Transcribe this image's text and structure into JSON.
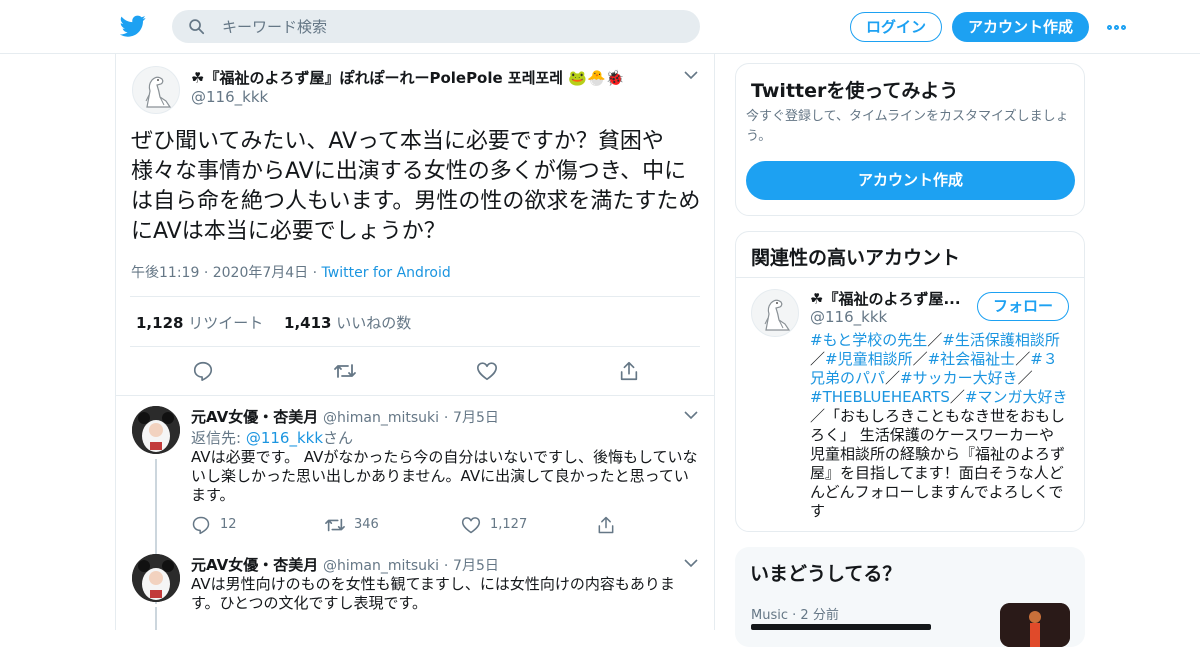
{
  "header": {
    "search_placeholder": "キーワード検索",
    "login_label": "ログイン",
    "signup_label": "アカウント作成"
  },
  "tweet": {
    "author_name": "☘『福祉のよろず屋』ぽれぽーれーPolePole 포레포레",
    "author_emojis": "🐸🐣🐞",
    "author_handle": "@116_kkk",
    "text": "ぜひ聞いてみたい、AVって本当に必要ですか？貧困や様々な事情からAVに出演する女性の多くが傷つき、中には自ら命を絶つ人もいます。男性の性の欲求を満たすためにAVは本当に必要でしょうか？",
    "time": "午後11:19",
    "date": "2020年7月4日",
    "sep": "·",
    "source": "Twitter for Android",
    "retweets_count": "1,128",
    "retweets_label": "リツイート",
    "likes_count": "1,413",
    "likes_label": "いいねの数"
  },
  "replies": [
    {
      "name": "元AV女優・杏美月",
      "handle": "@himan_mitsuki",
      "date": "7月5日",
      "reply_to_prefix": "返信先: ",
      "reply_to_handle": "@116_kkk",
      "reply_to_suffix": "さん",
      "text": "AVは必要です。 AVがなかったら今の自分はいないですし、後悔もしていないし楽しかった思い出しかありません。AVに出演して良かったと思っています。",
      "replies": "12",
      "retweets": "346",
      "likes": "1,127"
    },
    {
      "name": "元AV女優・杏美月",
      "handle": "@himan_mitsuki",
      "date": "7月5日",
      "text": "AVは男性向けのものを女性も観てますし、には女性向けの内容もあります。ひとつの文化ですし表現です。"
    }
  ],
  "sidebar": {
    "signup_card": {
      "title": "Twitterを使ってみよう",
      "subtitle": "今すぐ登録して、タイムラインをカスタマイズしましょう。",
      "button": "アカウント作成"
    },
    "related_card": {
      "title": "関連性の高いアカウント",
      "name": "☘『福祉のよろず屋...",
      "handle": "@116_kkk",
      "follow_label": "フォロー",
      "bio_parts": [
        {
          "t": "#もと学校の先生",
          "h": true
        },
        {
          "t": "／",
          "h": false
        },
        {
          "t": "#生活保護相談所",
          "h": true
        },
        {
          "t": "／",
          "h": false
        },
        {
          "t": "#児童相談所",
          "h": true
        },
        {
          "t": "／",
          "h": false
        },
        {
          "t": "#社会福祉士",
          "h": true
        },
        {
          "t": "／",
          "h": false
        },
        {
          "t": "#３兄弟のパパ",
          "h": true
        },
        {
          "t": "／",
          "h": false
        },
        {
          "t": "#サッカー大好き",
          "h": true
        },
        {
          "t": "／",
          "h": false
        },
        {
          "t": "#THEBLUEHEARTS",
          "h": true
        },
        {
          "t": "／",
          "h": false
        },
        {
          "t": "#マンガ大好き",
          "h": true
        },
        {
          "t": "／「おもしろきこともなき世をおもしろく」 生活保護のケースワーカーや児童相談所の経験から『福祉のよろず屋』を目指してます！面白そうな人どんどんフォローしますんでよろしくです",
          "h": false
        }
      ]
    },
    "trends_card": {
      "title": "いまどうしてる？",
      "category": "Music",
      "sep": "·",
      "time": "2 分前"
    }
  },
  "colors": {
    "accent": "#1da1f2",
    "link": "#1b95e0",
    "muted": "#657786",
    "border": "#e6ecf0"
  }
}
